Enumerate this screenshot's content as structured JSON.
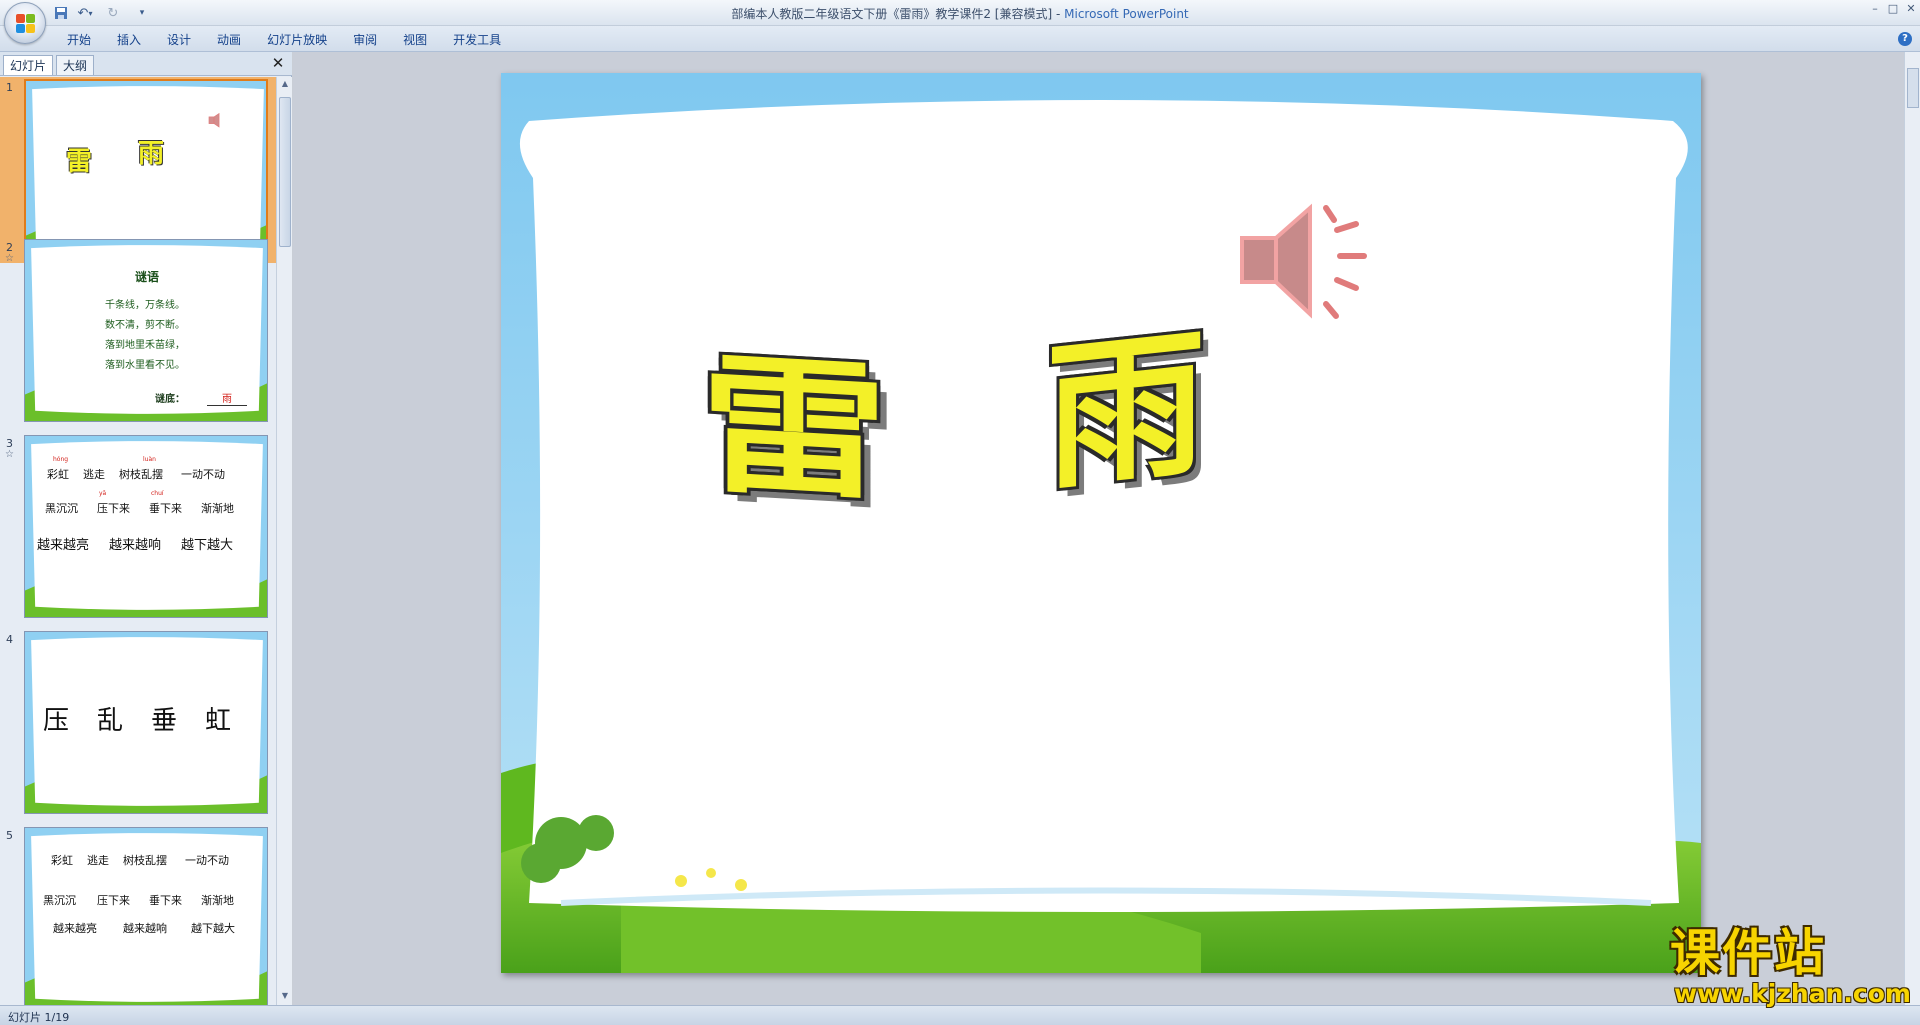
{
  "window": {
    "title_doc": "部编本人教版二年级语文下册《雷雨》教学课件2 [兼容模式] - ",
    "title_app": "Microsoft PowerPoint"
  },
  "ribbon": {
    "tabs": [
      "开始",
      "插入",
      "设计",
      "动画",
      "幻灯片放映",
      "审阅",
      "视图",
      "开发工具"
    ]
  },
  "left_pane": {
    "tabs": [
      "幻灯片",
      "大纲"
    ]
  },
  "thumbnails": [
    {
      "number": "1",
      "title_chars": [
        "雷",
        "雨"
      ]
    },
    {
      "number": "2",
      "heading": "谜语",
      "lines": [
        "千条线，万条线。",
        "数不清，剪不断。",
        "落到地里禾苗绿，",
        "落到水里看不见。"
      ],
      "answer_label": "谜底：",
      "answer": "雨"
    },
    {
      "number": "3",
      "row1": [
        "彩虹",
        "逃走",
        "树枝乱摆",
        "一动不动"
      ],
      "pinyin": [
        "hóng",
        "luàn",
        "yā",
        "chuí"
      ],
      "row2": [
        "黑沉沉",
        "压下来",
        "垂下来",
        "渐渐地"
      ],
      "row3": [
        "越来越亮",
        "越来越响",
        "越下越大"
      ]
    },
    {
      "number": "4",
      "chars": [
        "压",
        "乱",
        "垂",
        "虹"
      ]
    },
    {
      "number": "5",
      "row1": [
        "彩虹",
        "逃走",
        "树枝乱摆",
        "一动不动"
      ],
      "row2": [
        "黑沉沉",
        "压下来",
        "垂下来",
        "渐渐地"
      ],
      "row3": [
        "越来越亮",
        "越来越响",
        "越下越大"
      ]
    }
  ],
  "slide": {
    "title_chars": [
      "雷",
      "雨"
    ]
  },
  "statusbar": {
    "text": "幻灯片 1/19"
  },
  "watermark": {
    "title": "课件站",
    "url": "www.kjzhan.com"
  },
  "colors": {
    "accent_selected": "#f1b26b",
    "title_fill": "#f3f028",
    "sky_blue": "#8fd0f2",
    "grass_green": "#6bbf2a"
  }
}
